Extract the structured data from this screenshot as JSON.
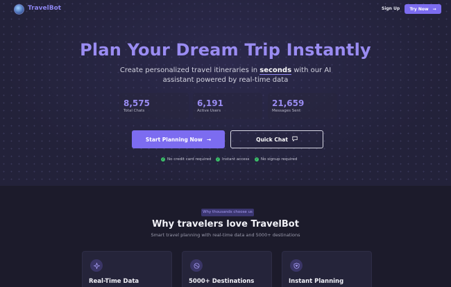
{
  "nav": {
    "brand": "TravelBot",
    "signup_label": "Sign Up",
    "try_label": "Try Now",
    "try_icon": "arrow-right-icon"
  },
  "hero": {
    "title": "Plan Your Dream Trip Instantly",
    "subtitle_before": "Create personalized travel itineraries in ",
    "subtitle_highlight": "seconds",
    "subtitle_after": " with our AI assistant powered by real-time data",
    "stats": [
      {
        "value": "8,575",
        "label": "Total Chats"
      },
      {
        "value": "6,191",
        "label": "Active Users"
      },
      {
        "value": "21,659",
        "label": "Messages Sent"
      }
    ],
    "primary_button": "Start Planning Now",
    "secondary_button": "Quick Chat",
    "checks": [
      "No credit card required",
      "Instant access",
      "No signup required"
    ]
  },
  "features": {
    "pill": "Why thousands choose us",
    "title": "Why travelers love TravelBot",
    "subtitle": "Smart travel planning with real-time data and 5000+ destinations",
    "cards": [
      {
        "title": "Real-Time Data",
        "icon": "sparkle-icon"
      },
      {
        "title": "5000+ Destinations",
        "icon": "globe-icon"
      },
      {
        "title": "Instant Planning",
        "icon": "shield-heart-icon"
      }
    ]
  },
  "colors": {
    "accent": "#7c6cf0",
    "title_accent": "#9a8cf2",
    "check_green": "#3cc16a",
    "background": "#1c1b2b"
  }
}
